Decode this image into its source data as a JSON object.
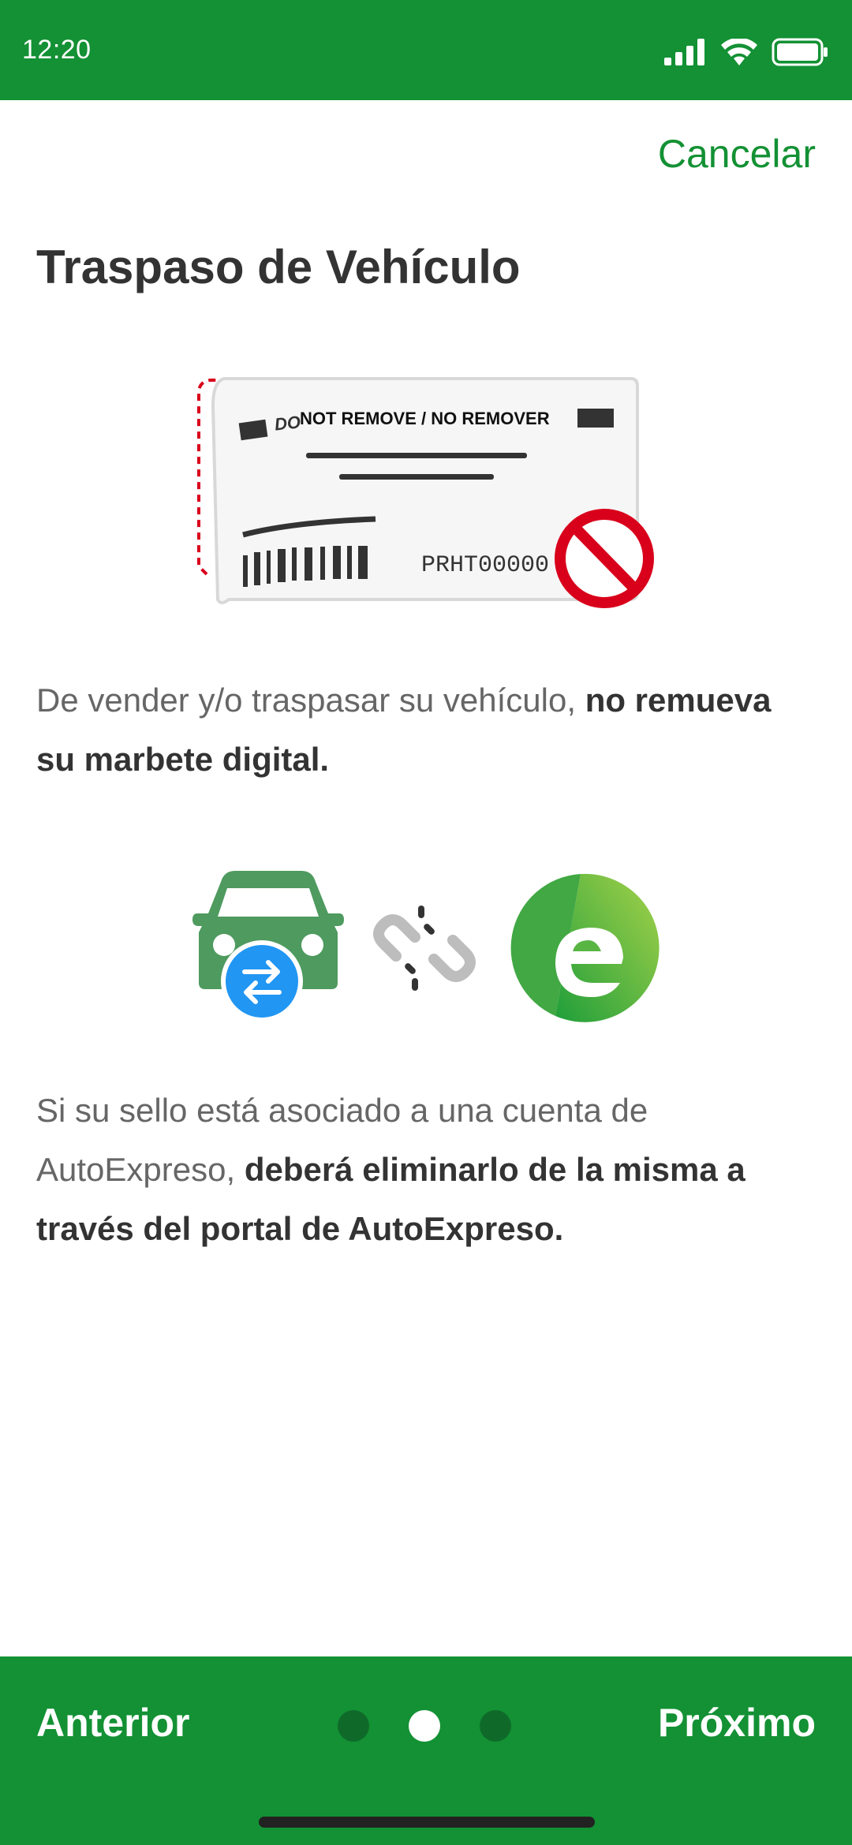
{
  "status_bar": {
    "time": "12:20"
  },
  "header": {
    "cancel_label": "Cancelar"
  },
  "page": {
    "title": "Traspaso de Vehículo"
  },
  "sticker": {
    "warning_text": "NOT REMOVE / NO REMOVER",
    "do_text": "DO",
    "plate_code": "PRHT00000"
  },
  "paragraph1": {
    "normal": "De vender y/o traspasar su vehículo, ",
    "bold": "no remueva su marbete digital."
  },
  "paragraph2": {
    "normal": "Si su sello está asociado a una cuenta de AutoExpreso, ",
    "bold": "deberá eliminarlo de la misma a través del portal de AutoExpreso."
  },
  "icons": {
    "car": "car-transfer-icon",
    "link": "broken-link-icon",
    "brand": "autoexpreso-logo-icon"
  },
  "footer": {
    "prev_label": "Anterior",
    "next_label": "Próximo",
    "page_indicator": {
      "count": 3,
      "active_index": 1
    }
  },
  "colors": {
    "brand_green": "#139134",
    "link_gray": "#bdbdbd",
    "badge_blue": "#2196f3",
    "prohibit_red": "#d9001b"
  }
}
